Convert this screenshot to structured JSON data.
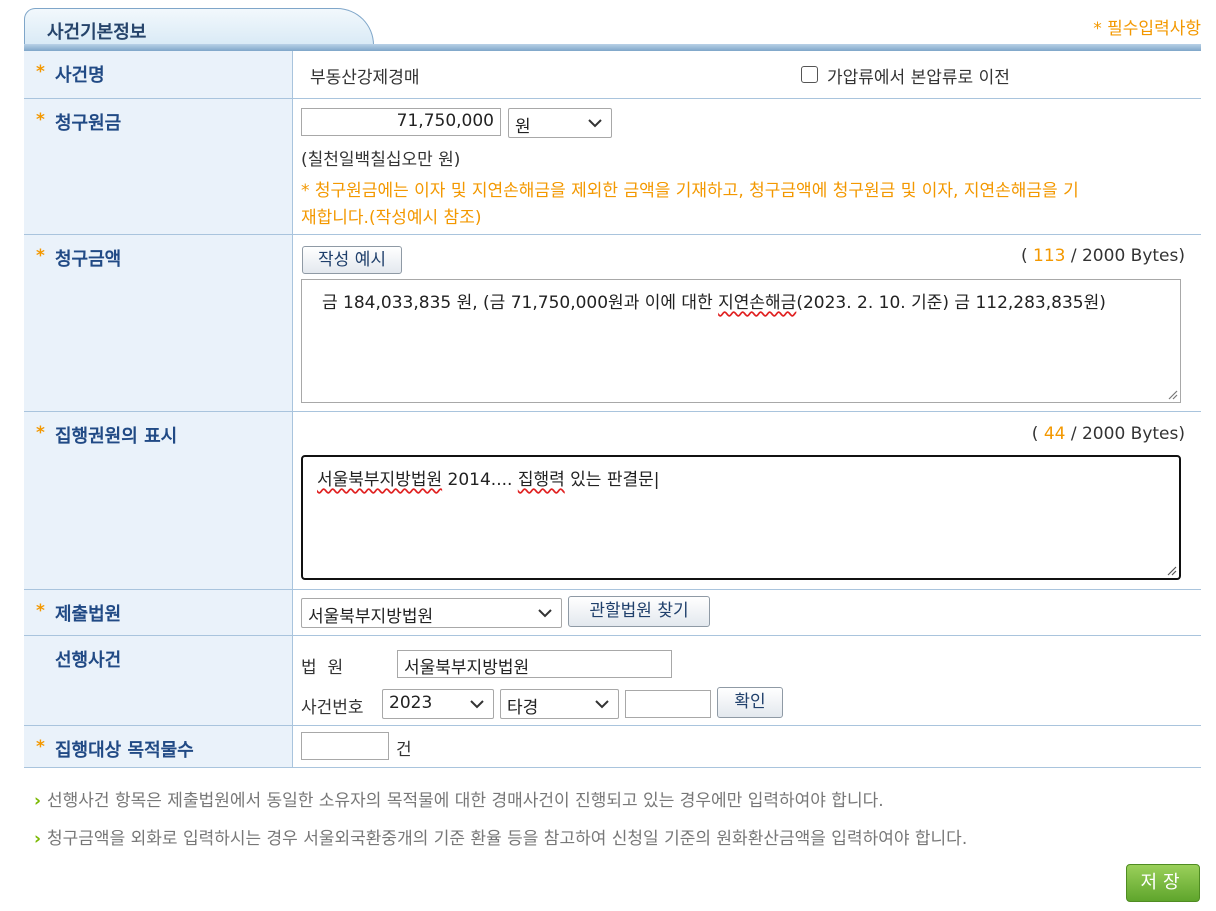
{
  "section": {
    "title": "사건기본정보",
    "required_note": "* 필수입력사항"
  },
  "case_name": {
    "label": "사건명",
    "value": "부동산강제경매",
    "checkbox_label": "가압류에서 본압류로 이전",
    "checkbox_checked": false
  },
  "principal": {
    "label": "청구원금",
    "amount": "71,750,000",
    "currency": "원",
    "amount_korean": "(칠천일백칠십오만 원)",
    "note_line1": "* 청구원금에는 이자 및 지연손해금을 제외한 금액을 기재하고, 청구금액에 청구원금 및 이자, 지연손해금을 기",
    "note_line2": "재합니다.(작성예시 참조)"
  },
  "claim_amount": {
    "label": "청구금액",
    "example_button": "작성 예시",
    "bytes_used": "113",
    "bytes_total": "/ 2000 Bytes)",
    "bytes_open": "(",
    "text_a": "금 184,033,835 원, (금 71,750,000원과 이에 대한 ",
    "text_b": "지연손해금",
    "text_c": "(2023. 2. 10. 기준)  금 112,283,835원)"
  },
  "title_display": {
    "label": "집행권원의 표시",
    "bytes_used": "44",
    "bytes_total": "/ 2000 Bytes)",
    "bytes_open": "(",
    "text_a": "서울북부지방법원",
    "text_b": " 2014.... ",
    "text_c": "집행력",
    "text_d": " 있는 판결문|"
  },
  "court": {
    "label": "제출법원",
    "selected": "서울북부지방법원",
    "find_button": "관할법원 찾기"
  },
  "prior_case": {
    "label": "선행사건",
    "court_label": "법  원",
    "court_value": "서울북부지방법원",
    "case_no_label": "사건번호",
    "year": "2023",
    "type": "타경",
    "number": "",
    "confirm_button": "확인"
  },
  "target_count": {
    "label": "집행대상 목적물수",
    "value": "",
    "unit": "건"
  },
  "notes": [
    "선행사건 항목은 제출법원에서 동일한 소유자의 목적물에 대한 경매사건이 진행되고 있는 경우에만 입력하여야 합니다.",
    "청구금액을 외화로 입력하시는 경우 서울외국환중개의 기준 환율 등을 참고하여 신청일 기준의 원화환산금액을 입력하여야 합니다."
  ],
  "save_button": "저장",
  "colors": {
    "required": "#f39800",
    "label_bg": "#eaf2fa",
    "label_text": "#214a85",
    "save": "#6cb33a"
  }
}
